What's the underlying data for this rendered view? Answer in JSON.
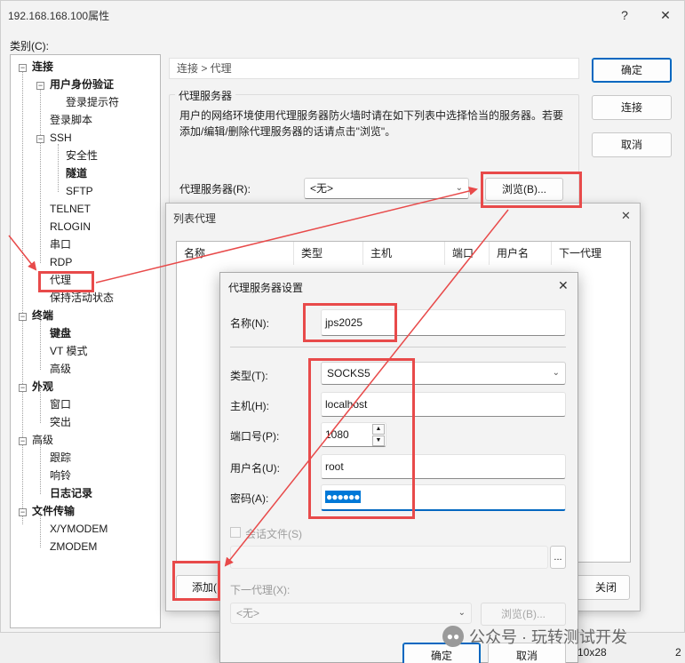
{
  "window": {
    "title": "192.168.168.100属性",
    "help_glyph": "?",
    "close_glyph": "✕"
  },
  "category_label": "类别(C):",
  "tree": {
    "connection": "连接",
    "user_auth": "用户身份验证",
    "login_prompt": "登录提示符",
    "login_script": "登录脚本",
    "ssh": "SSH",
    "security": "安全性",
    "tunnel": "隧道",
    "sftp": "SFTP",
    "telnet": "TELNET",
    "rlogin": "RLOGIN",
    "serial": "串口",
    "rdp": "RDP",
    "proxy": "代理",
    "keepalive": "保持活动状态",
    "terminal": "终端",
    "keyboard": "键盘",
    "vt_mode": "VT 模式",
    "advanced1": "高级",
    "appearance": "外观",
    "window": "窗口",
    "highlight": "突出",
    "advanced2": "高级",
    "trace": "跟踪",
    "bell": "响铃",
    "logging": "日志记录",
    "file_transfer": "文件传输",
    "xymodem": "X/YMODEM",
    "zmodem": "ZMODEM",
    "expand_minus": "−"
  },
  "path_text": "连接 > 代理",
  "proxy_group": {
    "title": "代理服务器",
    "description": "用户的网络环境使用代理服务器防火墙时请在如下列表中选择恰当的服务器。若要添加/编辑/删除代理服务器的话请点击\"浏览\"。",
    "server_label": "代理服务器(R):",
    "server_value": "<无>",
    "browse_label": "浏览(B)..."
  },
  "right_buttons": {
    "ok": "确定",
    "connect": "连接",
    "cancel": "取消"
  },
  "list_dialog": {
    "title": "列表代理",
    "close_glyph": "✕",
    "columns": [
      "名称",
      "类型",
      "主机",
      "端口",
      "用户名",
      "下一代理"
    ],
    "add_label": "添加(",
    "close_label": "关闭",
    "status_text": "10x28",
    "page_num": "2"
  },
  "settings_dialog": {
    "title": "代理服务器设置",
    "close_glyph": "✕",
    "name_label": "名称(N):",
    "name_value": "jps2025",
    "type_label": "类型(T):",
    "type_value": "SOCKS5",
    "host_label": "主机(H):",
    "host_value": "localhost",
    "port_label": "端口号(P):",
    "port_value": "1080",
    "user_label": "用户名(U):",
    "user_value": "root",
    "password_label": "密码(A):",
    "password_value": "●●●●●●",
    "session_file_label": "会话文件(S)",
    "more_glyph": "...",
    "next_proxy_label": "下一代理(X):",
    "next_proxy_value": "<无>",
    "browse2_label": "浏览(B)...",
    "ok_label": "确定",
    "cancel_label": "取消"
  },
  "watermark": {
    "text": "公众号 · 玩转测试开发"
  },
  "colors": {
    "annotation_red": "#e84a4a",
    "accent_blue": "#0067c0",
    "selection_blue": "#0078d7"
  }
}
